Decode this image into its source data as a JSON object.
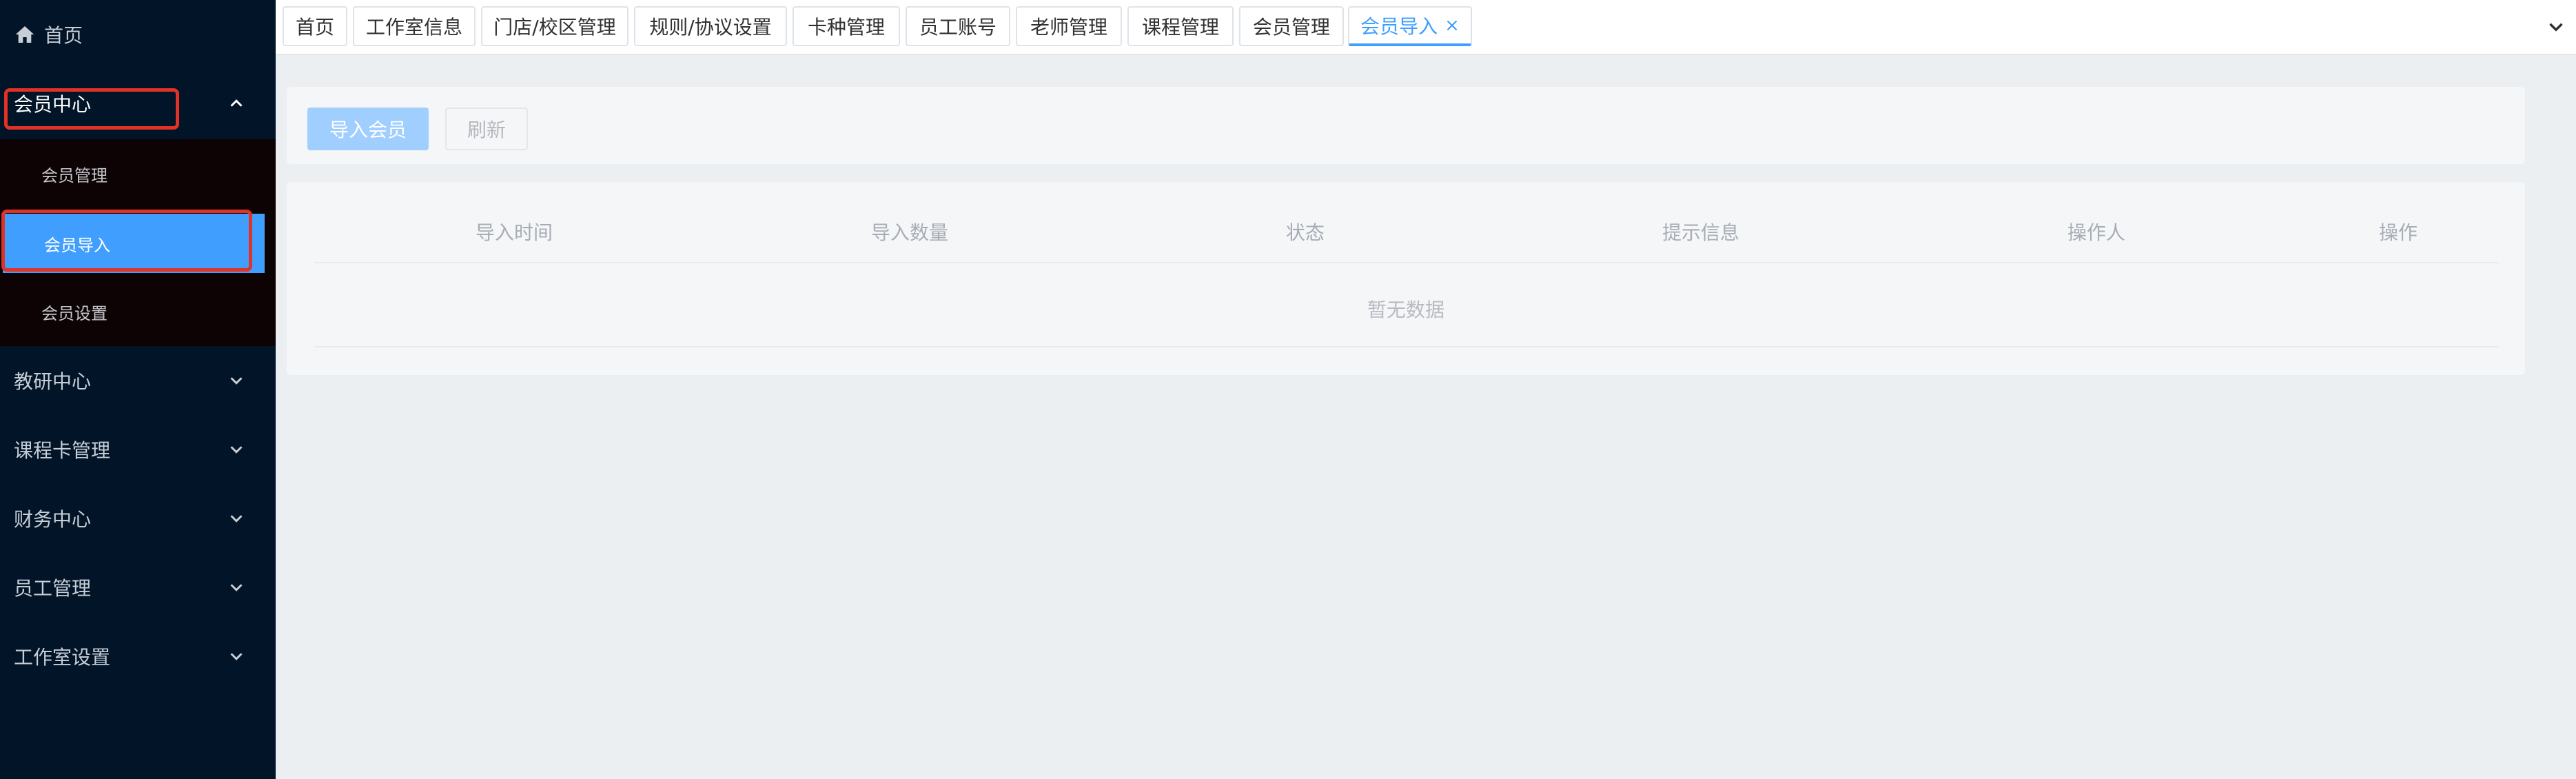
{
  "sidebar": {
    "home": "首页",
    "groups": [
      {
        "label": "会员中心",
        "expanded": true
      },
      {
        "label": "教研中心"
      },
      {
        "label": "课程卡管理"
      },
      {
        "label": "财务中心"
      },
      {
        "label": "员工管理"
      },
      {
        "label": "工作室设置"
      }
    ],
    "member_submenu": [
      "会员管理",
      "会员导入",
      "会员设置"
    ],
    "active_item": "会员导入"
  },
  "tabs": [
    {
      "label": "首页"
    },
    {
      "label": "工作室信息"
    },
    {
      "label": "门店/校区管理"
    },
    {
      "label": "规则/协议设置"
    },
    {
      "label": "卡种管理"
    },
    {
      "label": "员工账号"
    },
    {
      "label": "老师管理"
    },
    {
      "label": "课程管理"
    },
    {
      "label": "会员管理"
    },
    {
      "label": "会员导入",
      "active": true,
      "close": "×"
    }
  ],
  "toolbar": {
    "import": "导入会员",
    "refresh": "刷新"
  },
  "table": {
    "columns": [
      "导入时间",
      "导入数量",
      "状态",
      "提示信息",
      "操作人",
      "操作"
    ],
    "empty_text": "暂无数据"
  },
  "colors": {
    "primary": "#409eff",
    "sidebar_bg": "#011428",
    "highlight": "#e03225"
  }
}
